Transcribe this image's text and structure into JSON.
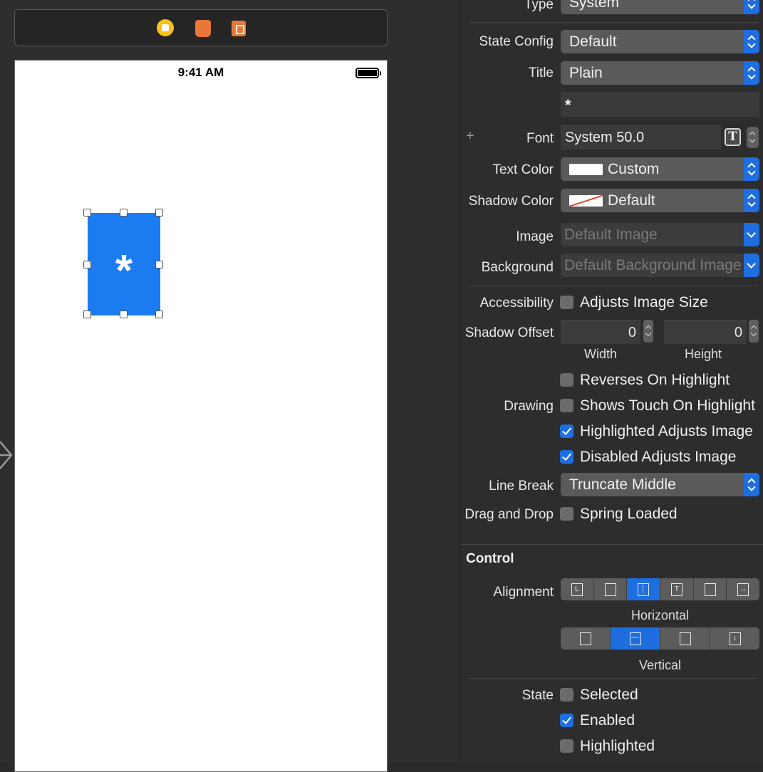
{
  "canvas": {
    "status_time": "9:41 AM",
    "button_title": "*",
    "scene_icons": [
      "view-controller-icon",
      "first-responder-icon",
      "exit-icon"
    ]
  },
  "inspector": {
    "type": {
      "label": "Type",
      "value": "System"
    },
    "state_config": {
      "label": "State Config",
      "value": "Default"
    },
    "title": {
      "label": "Title",
      "value": "Plain",
      "text": "*"
    },
    "font": {
      "label": "Font",
      "value": "System 50.0"
    },
    "text_color": {
      "label": "Text Color",
      "value": "Custom",
      "swatch": "#ffffff"
    },
    "shadow_color": {
      "label": "Shadow Color",
      "value": "Default"
    },
    "image": {
      "label": "Image",
      "placeholder": "Default Image"
    },
    "background": {
      "label": "Background",
      "placeholder": "Default Background Image"
    },
    "accessibility": {
      "label": "Accessibility",
      "option": "Adjusts Image Size",
      "checked": false
    },
    "shadow_offset": {
      "label": "Shadow Offset",
      "width": "0",
      "height": "0",
      "width_label": "Width",
      "height_label": "Height"
    },
    "drawing": {
      "label": "Drawing",
      "options": [
        {
          "text": "Reverses On Highlight",
          "checked": false
        },
        {
          "text": "Shows Touch On Highlight",
          "checked": false
        },
        {
          "text": "Highlighted Adjusts Image",
          "checked": true
        },
        {
          "text": "Disabled Adjusts Image",
          "checked": true
        }
      ]
    },
    "line_break": {
      "label": "Line Break",
      "value": "Truncate Middle"
    },
    "drag_drop": {
      "label": "Drag and Drop",
      "option": "Spring Loaded",
      "checked": false
    },
    "control": {
      "section": "Control",
      "alignment_label": "Alignment",
      "horizontal_label": "Horizontal",
      "vertical_label": "Vertical",
      "horizontal_selected": 2,
      "vertical_selected": 1
    },
    "state": {
      "label": "State",
      "options": [
        {
          "text": "Selected",
          "checked": false
        },
        {
          "text": "Enabled",
          "checked": true
        },
        {
          "text": "Highlighted",
          "checked": false
        }
      ]
    }
  },
  "colors": {
    "accent": "#1f6ee0",
    "button_fill": "#1b7cf2",
    "panel": "#2d2d2d"
  }
}
